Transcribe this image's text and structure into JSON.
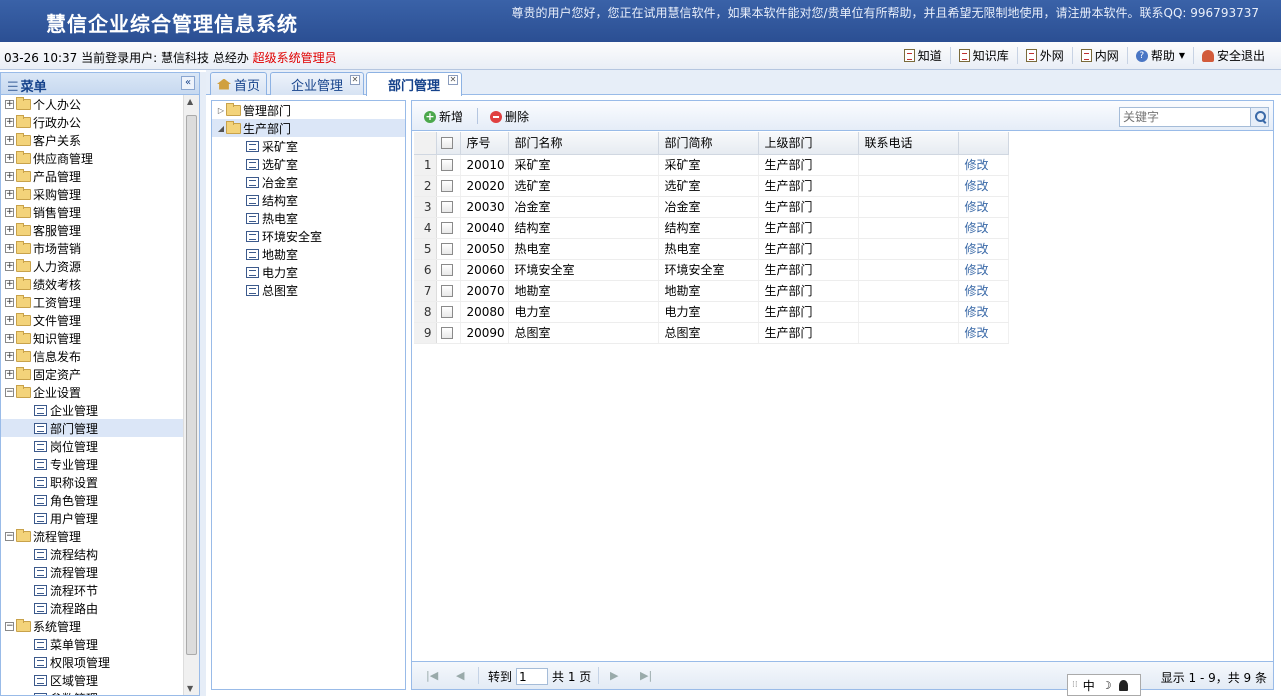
{
  "header": {
    "title": "慧信企业综合管理信息系统",
    "notice": "尊贵的用户您好，您正在试用慧信软件，如果本软件能对您/贵单位有所帮助，并且希望无限制地使用，请注册本软件。联系QQ: 996793737"
  },
  "infobar": {
    "datetime": "03-26 10:37",
    "user_prefix": "当前登录用户:",
    "user": "慧信科技",
    "dept": "总经办",
    "role": "超级系统管理员",
    "links": [
      "知道",
      "知识库",
      "外网",
      "内网",
      "帮助",
      "安全退出"
    ]
  },
  "menu": {
    "title": "菜单",
    "items": [
      {
        "label": "个人办公",
        "type": "folder"
      },
      {
        "label": "行政办公",
        "type": "folder"
      },
      {
        "label": "客户关系",
        "type": "folder"
      },
      {
        "label": "供应商管理",
        "type": "folder"
      },
      {
        "label": "产品管理",
        "type": "folder"
      },
      {
        "label": "采购管理",
        "type": "folder"
      },
      {
        "label": "销售管理",
        "type": "folder"
      },
      {
        "label": "客服管理",
        "type": "folder"
      },
      {
        "label": "市场营销",
        "type": "folder"
      },
      {
        "label": "人力资源",
        "type": "folder"
      },
      {
        "label": "绩效考核",
        "type": "folder"
      },
      {
        "label": "工资管理",
        "type": "folder"
      },
      {
        "label": "文件管理",
        "type": "folder"
      },
      {
        "label": "知识管理",
        "type": "folder"
      },
      {
        "label": "信息发布",
        "type": "folder"
      },
      {
        "label": "固定资产",
        "type": "folder"
      },
      {
        "label": "企业设置",
        "type": "open"
      },
      {
        "label": "企业管理",
        "type": "leaf"
      },
      {
        "label": "部门管理",
        "type": "leaf",
        "selected": true
      },
      {
        "label": "岗位管理",
        "type": "leaf"
      },
      {
        "label": "专业管理",
        "type": "leaf"
      },
      {
        "label": "职称设置",
        "type": "leaf"
      },
      {
        "label": "角色管理",
        "type": "leaf"
      },
      {
        "label": "用户管理",
        "type": "leaf"
      },
      {
        "label": "流程管理",
        "type": "open"
      },
      {
        "label": "流程结构",
        "type": "leaf"
      },
      {
        "label": "流程管理",
        "type": "leaf"
      },
      {
        "label": "流程环节",
        "type": "leaf"
      },
      {
        "label": "流程路由",
        "type": "leaf"
      },
      {
        "label": "系统管理",
        "type": "open"
      },
      {
        "label": "菜单管理",
        "type": "leaf"
      },
      {
        "label": "权限项管理",
        "type": "leaf"
      },
      {
        "label": "区域管理",
        "type": "leaf"
      },
      {
        "label": "参数管理",
        "type": "leaf"
      }
    ]
  },
  "tabs": [
    {
      "label": "首页",
      "closable": false
    },
    {
      "label": "企业管理",
      "closable": true
    },
    {
      "label": "部门管理",
      "closable": true,
      "active": true
    }
  ],
  "dept_tree": [
    {
      "label": "管理部门",
      "type": "folder",
      "collapsed": true
    },
    {
      "label": "生产部门",
      "type": "folder",
      "selected": true
    },
    {
      "label": "采矿室",
      "type": "leaf"
    },
    {
      "label": "选矿室",
      "type": "leaf"
    },
    {
      "label": "冶金室",
      "type": "leaf"
    },
    {
      "label": "结构室",
      "type": "leaf"
    },
    {
      "label": "热电室",
      "type": "leaf"
    },
    {
      "label": "环境安全室",
      "type": "leaf"
    },
    {
      "label": "地勘室",
      "type": "leaf"
    },
    {
      "label": "电力室",
      "type": "leaf"
    },
    {
      "label": "总图室",
      "type": "leaf"
    }
  ],
  "toolbar": {
    "add_label": "新增",
    "delete_label": "删除",
    "search_placeholder": "关键字"
  },
  "grid": {
    "columns": [
      "序号",
      "部门名称",
      "部门简称",
      "上级部门",
      "联系电话",
      ""
    ],
    "edit_label": "修改",
    "rows": [
      {
        "n": "1",
        "code": "20010",
        "name": "采矿室",
        "short": "采矿室",
        "parent": "生产部门",
        "phone": ""
      },
      {
        "n": "2",
        "code": "20020",
        "name": "选矿室",
        "short": "选矿室",
        "parent": "生产部门",
        "phone": ""
      },
      {
        "n": "3",
        "code": "20030",
        "name": "冶金室",
        "short": "冶金室",
        "parent": "生产部门",
        "phone": ""
      },
      {
        "n": "4",
        "code": "20040",
        "name": "结构室",
        "short": "结构室",
        "parent": "生产部门",
        "phone": ""
      },
      {
        "n": "5",
        "code": "20050",
        "name": "热电室",
        "short": "热电室",
        "parent": "生产部门",
        "phone": ""
      },
      {
        "n": "6",
        "code": "20060",
        "name": "环境安全室",
        "short": "环境安全室",
        "parent": "生产部门",
        "phone": ""
      },
      {
        "n": "7",
        "code": "20070",
        "name": "地勘室",
        "short": "地勘室",
        "parent": "生产部门",
        "phone": ""
      },
      {
        "n": "8",
        "code": "20080",
        "name": "电力室",
        "short": "电力室",
        "parent": "生产部门",
        "phone": ""
      },
      {
        "n": "9",
        "code": "20090",
        "name": "总图室",
        "short": "总图室",
        "parent": "生产部门",
        "phone": ""
      }
    ]
  },
  "pager": {
    "goto_label": "转到",
    "page_value": "1",
    "total_label": "共 1 页",
    "info": "显示 1 - 9，共 9 条"
  },
  "ime": {
    "mode": "中"
  }
}
